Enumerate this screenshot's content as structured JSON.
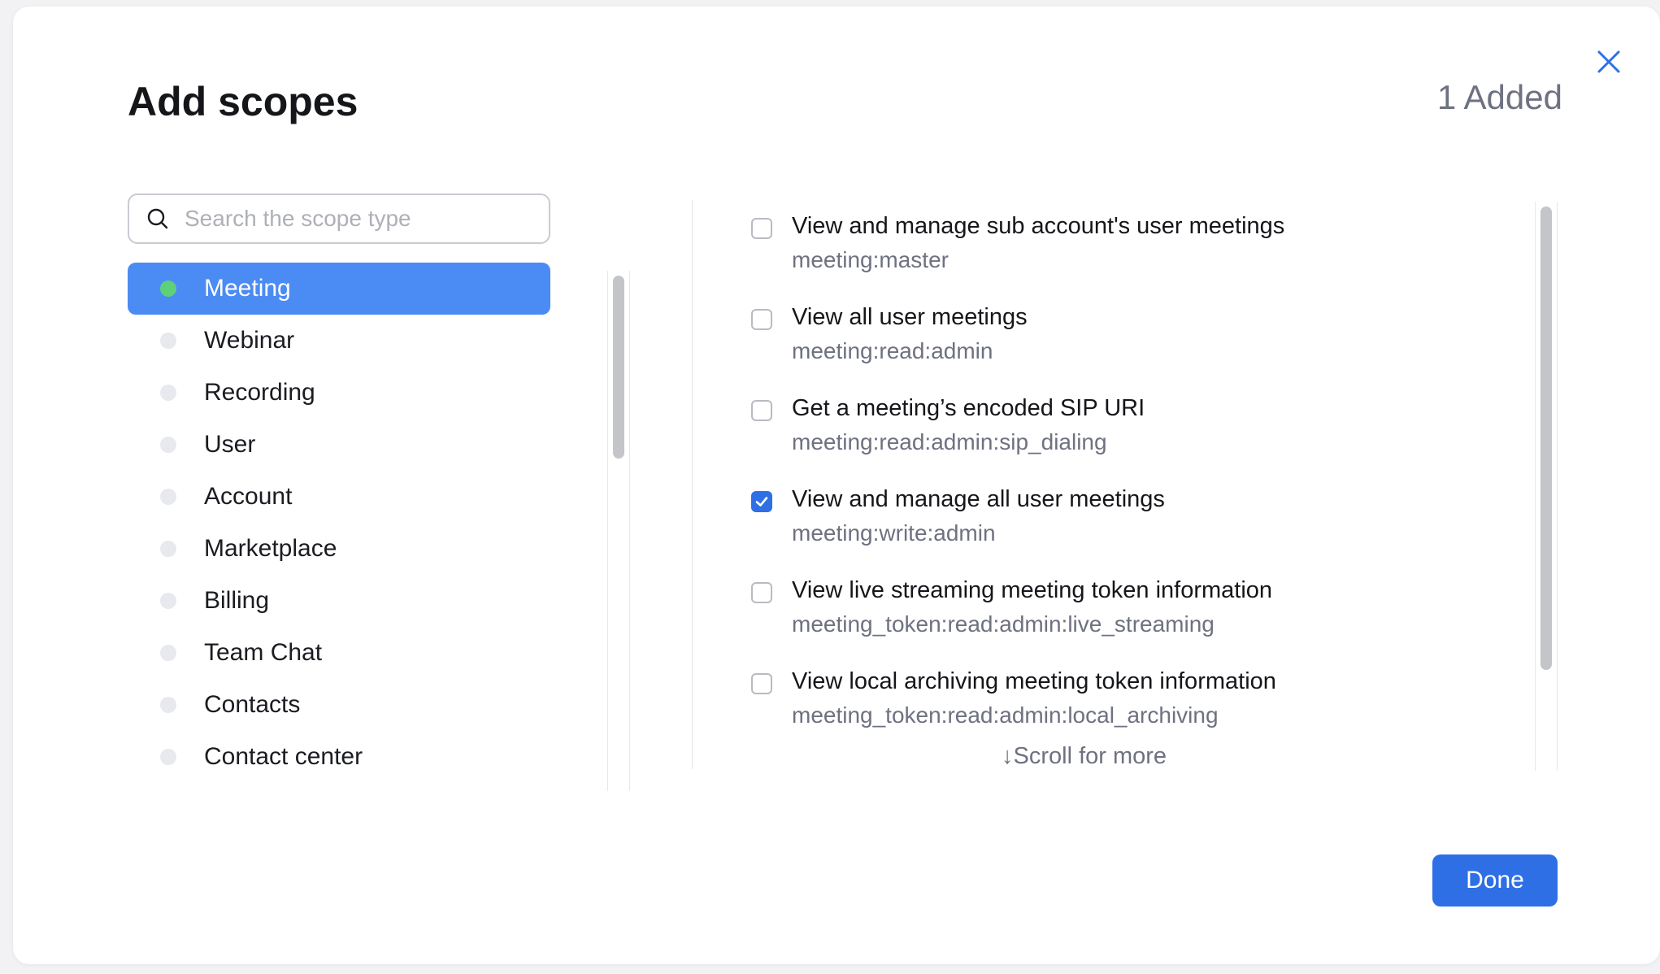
{
  "dialog": {
    "title": "Add scopes",
    "added_count_text": "1 Added",
    "done_label": "Done",
    "close_icon": "close-icon"
  },
  "search": {
    "placeholder": "Search the scope type",
    "value": ""
  },
  "categories": [
    {
      "label": "Meeting",
      "active": true
    },
    {
      "label": "Webinar",
      "active": false
    },
    {
      "label": "Recording",
      "active": false
    },
    {
      "label": "User",
      "active": false
    },
    {
      "label": "Account",
      "active": false
    },
    {
      "label": "Marketplace",
      "active": false
    },
    {
      "label": "Billing",
      "active": false
    },
    {
      "label": "Team Chat",
      "active": false
    },
    {
      "label": "Contacts",
      "active": false
    },
    {
      "label": "Contact center",
      "active": false
    }
  ],
  "scopes": [
    {
      "title": "View and manage sub account's user meetings",
      "code": "meeting:master",
      "checked": false
    },
    {
      "title": "View all user meetings",
      "code": "meeting:read:admin",
      "checked": false
    },
    {
      "title": "Get a meeting’s encoded SIP URI",
      "code": "meeting:read:admin:sip_dialing",
      "checked": false
    },
    {
      "title": "View and manage all user meetings",
      "code": "meeting:write:admin",
      "checked": true
    },
    {
      "title": "View live streaming meeting token information",
      "code": "meeting_token:read:admin:live_streaming",
      "checked": false
    },
    {
      "title": "View local archiving meeting token information",
      "code": "meeting_token:read:admin:local_archiving",
      "checked": false
    }
  ],
  "scroll_hint": "↓Scroll for more",
  "colors": {
    "accent": "#2f6fe6",
    "active_category_bg": "#4b8bf4",
    "active_dot": "#5fd07a"
  }
}
